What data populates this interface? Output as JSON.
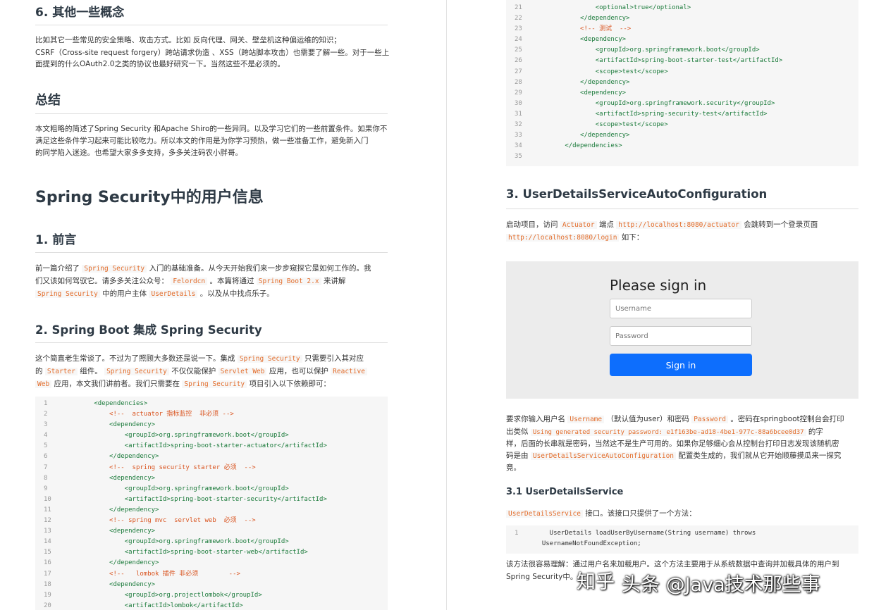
{
  "left": {
    "sec6_title": "6. 其他一些概念",
    "sec6_p1": "比如其它一些常见的安全策略、攻击方式。比如 反向代理、网关、壁垒机这种偏运维的知识；",
    "sec6_p2": "CSRF（Cross-site request forgery）跨站请求伪造 、XSS（跨站脚本攻击）也需要了解一些。对于一些上",
    "sec6_p3": "面提到的什么OAuth2.0之类的协议也最好研究一下。当然这些不是必须的。",
    "summary_title": "总结",
    "summary_p1": "本文粗略的简述了Spring Security 和Apache Shiro的一些异同。以及学习它们的一些前置条件。如果你不",
    "summary_p2": "满足这些条件学习起来可能比较吃力。所以本文的作用是为你学习预热，做一些准备工作，避免新入门",
    "summary_p3": "的同学陷入迷途。也希望大家多多支持，多多关注码农小胖哥。",
    "big_title": "Spring Security中的用户信息",
    "s1_title": "1. 前言",
    "s1_l1": {
      "a": "前一篇介绍了",
      "b": "Spring Security",
      "c": "入门的基础准备。从今天开始我们来一步步窥探它是如何工作的。我"
    },
    "s1_l2": {
      "a": "们又该如何驾驭它。请多多关注公众号：",
      "b": "Felordcn",
      "c": "。本篇将通过",
      "d": "Spring Boot 2.x",
      "e": "来讲解"
    },
    "s1_l3": {
      "a": "Spring Security",
      "b": "中的用户主体",
      "c": "UserDetails",
      "d": "。以及从中找点乐子。"
    },
    "s2_title": "2. Spring Boot 集成 Spring Security",
    "s2_l1": {
      "a": "这个简直老生常谈了。不过为了照顾大多数还是说一下。集成",
      "b": "Spring Security",
      "c": "只需要引入其对应"
    },
    "s2_l2": {
      "a": "的",
      "b": "Starter",
      "c": "组件。",
      "d": "Spring Security",
      "e": "不仅仅能保护",
      "f": "Servlet Web",
      "g": "应用，也可以保护",
      "h": "Reactive"
    },
    "s2_l3": {
      "a": "Web",
      "b": "应用，本文我们讲前者。我们只需要在",
      "c": "Spring Security",
      "d": "项目引入以下依赖即可："
    },
    "code": [
      {
        "n": "1",
        "t": "        <dependencies>"
      },
      {
        "n": "2",
        "t": "            <!--  actuator 指标监控  非必须 -->"
      },
      {
        "n": "3",
        "t": "            <dependency>"
      },
      {
        "n": "4",
        "t": "                <groupId>org.springframework.boot</groupId>"
      },
      {
        "n": "5",
        "t": "                <artifactId>spring-boot-starter-actuator</artifactId>"
      },
      {
        "n": "6",
        "t": "            </dependency>"
      },
      {
        "n": "7",
        "t": "            <!--  spring security starter 必须  -->"
      },
      {
        "n": "8",
        "t": "            <dependency>"
      },
      {
        "n": "9",
        "t": "                <groupId>org.springframework.boot</groupId>"
      },
      {
        "n": "10",
        "t": "                <artifactId>spring-boot-starter-security</artifactId>"
      },
      {
        "n": "11",
        "t": "            </dependency>"
      },
      {
        "n": "12",
        "t": "            <!-- spring mvc  servlet web  必须  -->"
      },
      {
        "n": "13",
        "t": "            <dependency>"
      },
      {
        "n": "14",
        "t": "                <groupId>org.springframework.boot</groupId>"
      },
      {
        "n": "15",
        "t": "                <artifactId>spring-boot-starter-web</artifactId>"
      },
      {
        "n": "16",
        "t": "            </dependency>"
      },
      {
        "n": "17",
        "t": "            <!--   lombok 插件 非必须        -->"
      },
      {
        "n": "18",
        "t": "            <dependency>"
      },
      {
        "n": "19",
        "t": "                <groupId>org.projectlombok</groupId>"
      },
      {
        "n": "20",
        "t": "                <artifactId>lombok</artifactId>"
      }
    ]
  },
  "right": {
    "code": [
      {
        "n": "21",
        "t": "                <optional>true</optional>"
      },
      {
        "n": "22",
        "t": "            </dependency>"
      },
      {
        "n": "23",
        "t": "            <!-- 测试  -->"
      },
      {
        "n": "24",
        "t": "            <dependency>"
      },
      {
        "n": "25",
        "t": "                <groupId>org.springframework.boot</groupId>"
      },
      {
        "n": "26",
        "t": "                <artifactId>spring-boot-starter-test</artifactId>"
      },
      {
        "n": "27",
        "t": "                <scope>test</scope>"
      },
      {
        "n": "28",
        "t": "            </dependency>"
      },
      {
        "n": "29",
        "t": "            <dependency>"
      },
      {
        "n": "30",
        "t": "                <groupId>org.springframework.security</groupId>"
      },
      {
        "n": "31",
        "t": "                <artifactId>spring-security-test</artifactId>"
      },
      {
        "n": "32",
        "t": "                <scope>test</scope>"
      },
      {
        "n": "33",
        "t": "            </dependency>"
      },
      {
        "n": "34",
        "t": "        </dependencies>"
      },
      {
        "n": "35",
        "t": ""
      }
    ],
    "s3_title": "3. UserDetailsServiceAutoConfiguration",
    "s3_l1": {
      "a": "启动项目，访问",
      "b": "Actuator",
      "c": "端点",
      "d": "http://localhost:8080/actuator",
      "e": "会跳转到一个登录页面"
    },
    "s3_l2": {
      "a": "http://localhost:8080/login",
      "b": "如下："
    },
    "login": {
      "title": "Please sign in",
      "username_placeholder": "Username",
      "password_placeholder": "Password",
      "button": "Sign in"
    },
    "after_l1": {
      "a": "要求你输入用户名",
      "b": "Username",
      "c": "（默认值为user）和密码",
      "d": "Password",
      "e": "。密码在springboot控制台会打印"
    },
    "after_l2": {
      "a": "出类似",
      "b": "Using generated security password: e1f163be-ad18-4be1-977c-88a6bcee0d37",
      "c": "的字"
    },
    "after_l3": "样，后面的长串就是密码，当然这不是生产可用的。如果你足够细心会从控制台打印日志发现该随机密",
    "after_l4": {
      "a": "码是由",
      "b": "UserDetailsServiceAutoConfiguration",
      "c": "配置类生成的，我们就从它开始顺藤摸瓜来一探究"
    },
    "after_l5": "竟。",
    "s31_title": "3.1 UserDetailsService",
    "s31_l1": {
      "a": "UserDetailsService",
      "b": "接口。该接口只提供了一个方法："
    },
    "method_code": [
      {
        "n": "1",
        "t": "    UserDetails loadUserByUsername(String username) throws"
      },
      {
        "n": "",
        "t": "  UsernameNotFoundException;"
      }
    ],
    "end_l1": "该方法很容易理解：通过用户名来加载用户。这个方法主要用于从系统数据中查询并加载具体的用户到",
    "end_l2": "Spring Security中。"
  },
  "watermarks": {
    "zhihu": "知乎",
    "toutiao": "头条 @Java技术那些事"
  }
}
